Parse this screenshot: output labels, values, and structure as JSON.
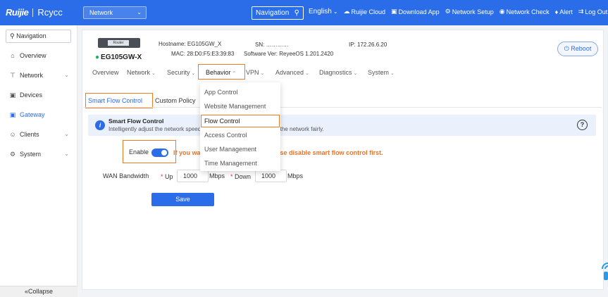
{
  "header": {
    "brand_primary": "Ruijie",
    "brand_secondary": "Rcycc",
    "network_select": "Network",
    "navigation_search": "Navigation",
    "language": "English",
    "items": {
      "cloud": "Ruijie Cloud",
      "download": "Download App",
      "setup": "Network Setup",
      "check": "Network Check",
      "alert": "Alert",
      "logout": "Log Out"
    }
  },
  "sidebar": {
    "search_placeholder": "Navigation",
    "items": [
      {
        "label": "Overview",
        "icon": "home-icon"
      },
      {
        "label": "Network",
        "icon": "network-icon"
      },
      {
        "label": "Devices",
        "icon": "devices-icon"
      },
      {
        "label": "Gateway",
        "icon": "gateway-icon",
        "active": true
      },
      {
        "label": "Clients",
        "icon": "clients-icon"
      },
      {
        "label": "System",
        "icon": "gear-icon"
      }
    ],
    "collapse": "Collapse"
  },
  "device": {
    "icon_label": "Router",
    "name": "EG105GW-X",
    "hostname_label": "Hostname:",
    "hostname": "EG105GW_X",
    "sn_label": "SN:",
    "sn": "…………",
    "ip_label": "IP:",
    "ip": "172.26.6.20",
    "mac_label": "MAC:",
    "mac": "28:D0:F5:E3:39:83",
    "software_label": "Software Ver:",
    "software": "ReyeeOS 1.201.2420",
    "reboot": "Reboot"
  },
  "tabs": {
    "overview": "Overview",
    "network": "Network",
    "security": "Security",
    "behavior": "Behavior",
    "vpn": "VPN",
    "advanced": "Advanced",
    "diagnostics": "Diagnostics",
    "system": "System"
  },
  "subtabs": {
    "smart_flow": "Smart Flow Control",
    "custom_policy": "Custom Policy"
  },
  "info": {
    "title": "Smart Flow Control",
    "desc_left": "Intelligently adjust the network speed",
    "desc_right": "the network fairly."
  },
  "form": {
    "enable_label": "Enable",
    "enable_on": true,
    "warning_left": "If you wa",
    "warning_right": "se disable smart flow control first.",
    "wan_label": "WAN Bandwidth",
    "up_label": "Up",
    "up_value": "1000",
    "up_unit": "Mbps",
    "down_label": "Down",
    "down_value": "1000",
    "down_unit": "Mbps",
    "save": "Save"
  },
  "dropdown": {
    "items": [
      "App Control",
      "Website Management",
      "Flow Control",
      "Access Control",
      "User Management",
      "Time Management"
    ],
    "selected": "Flow Control"
  },
  "colors": {
    "accent": "#2b6de9",
    "highlight": "#f07b25",
    "warning": "#e8742b",
    "online": "#1bb45a"
  }
}
